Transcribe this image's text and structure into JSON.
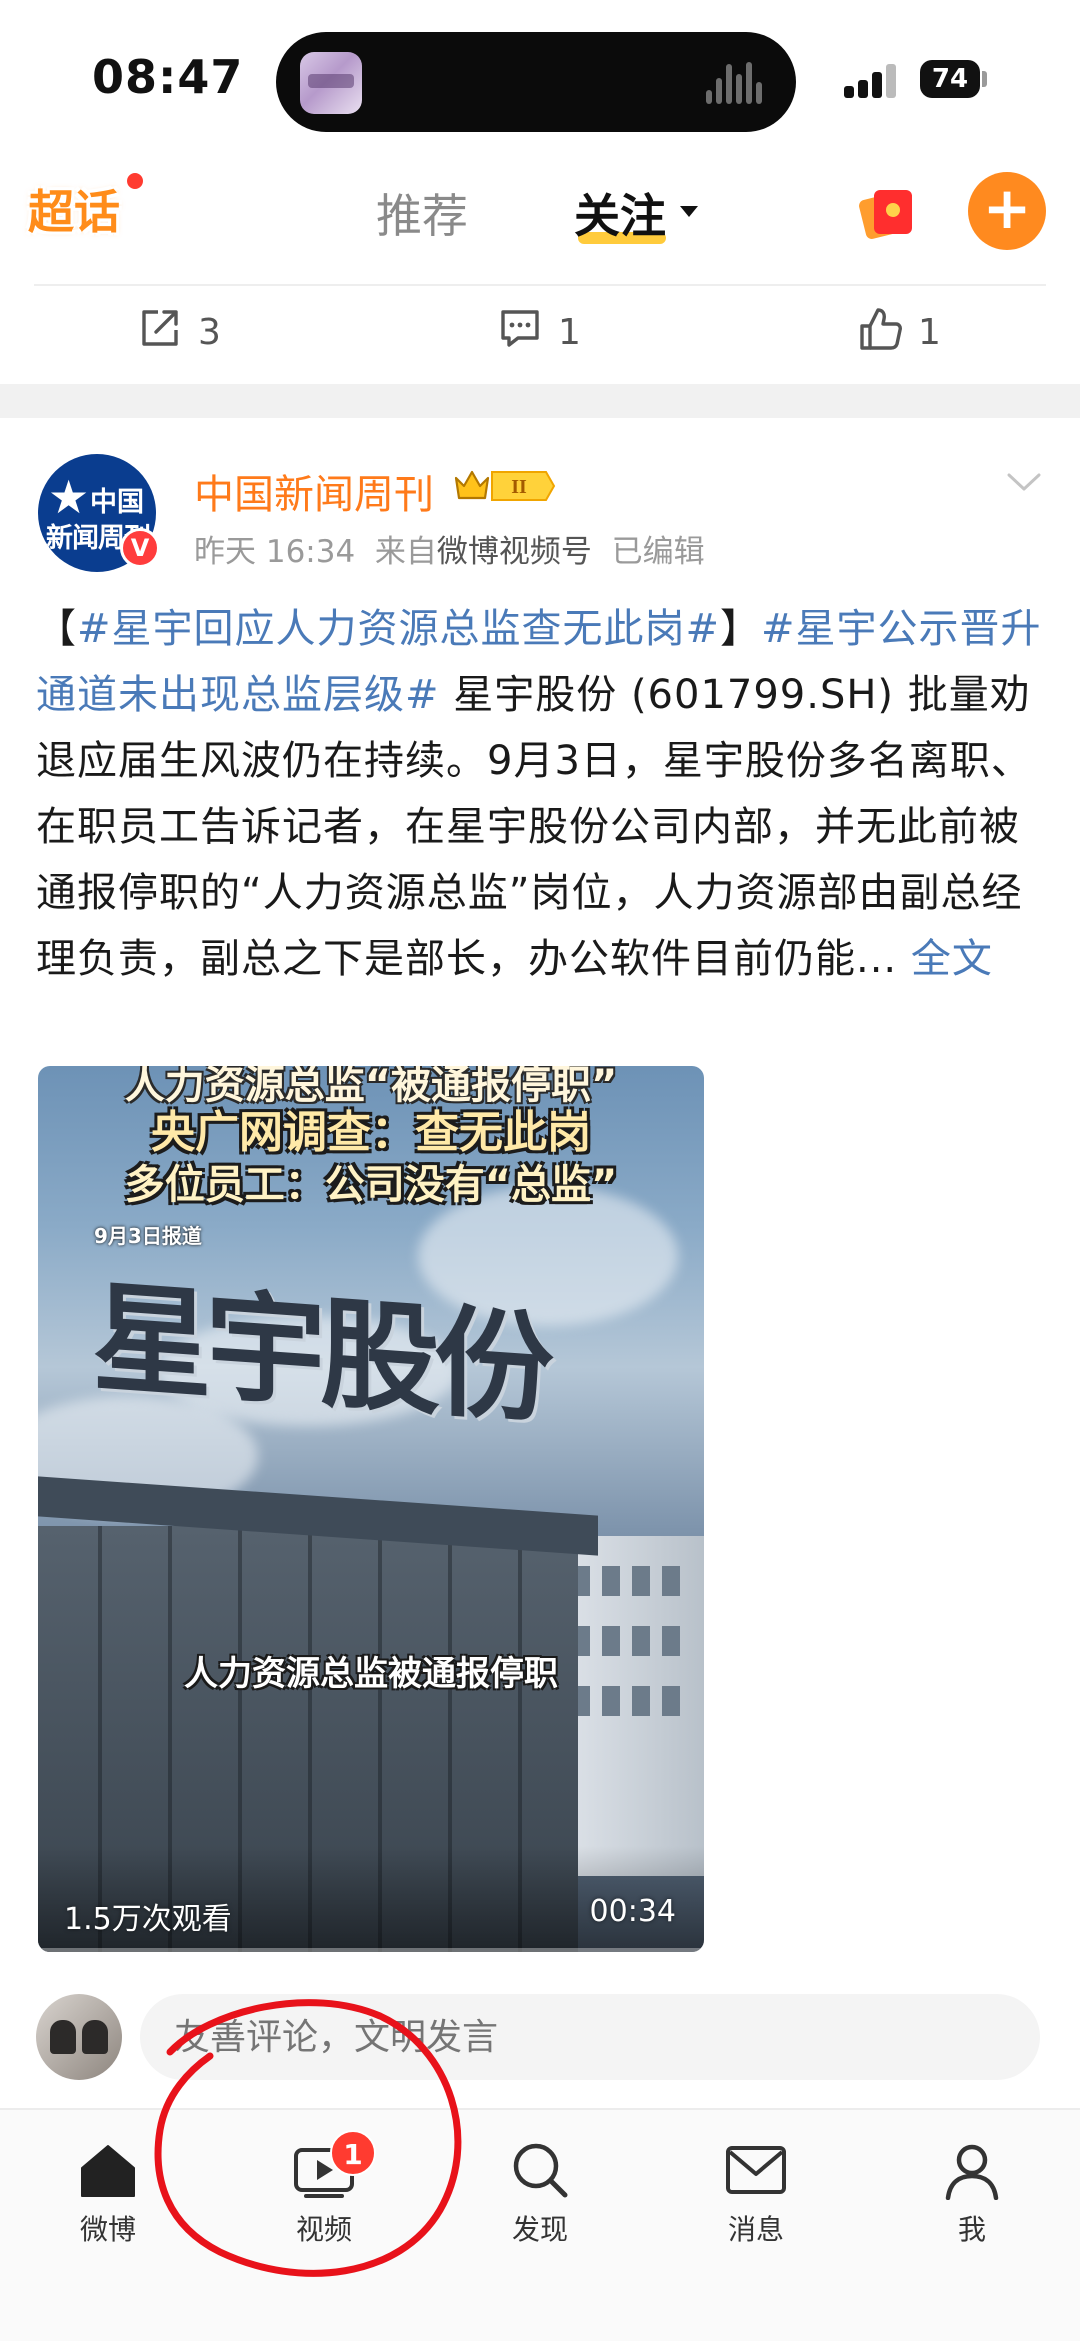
{
  "status_bar": {
    "time": "08:47",
    "battery": "74"
  },
  "top_nav": {
    "logo": "超话",
    "tabs": [
      {
        "label": "推荐"
      },
      {
        "label": "关注"
      }
    ]
  },
  "prev_post_actions": {
    "repost_count": "3",
    "comment_count": "1",
    "like_count": "1"
  },
  "post": {
    "author": "中国新闻周刊",
    "avatar_text_1": "中国",
    "avatar_text_2": "新闻周刊",
    "verified": "V",
    "vip_level": "II",
    "time": "昨天 16:34",
    "from_prefix": "来自",
    "source": "微博视频号",
    "edited": "已编辑",
    "body": {
      "bracket_open": "【",
      "tag1": "#星宇回应人力资源总监查无此岗#",
      "bracket_close": "】",
      "tag2": "#星宇公示晋升通道未出现总监层级#",
      "text": " 星宇股份 (601799.SH) 批量劝退应届生风波仍在持续。9月3日，星宇股份多名离职、在职员工告诉记者，在星宇股份公司内部，并无此前被通报停职的“人力资源总监”岗位，人力资源部由副总经理负责，副总之下是部长，办公软件目前仍能...",
      "full_text_link": "全文"
    },
    "video": {
      "caption_1": "人力资源总监“被通报停职”",
      "caption_2": "央广网调查：查无此岗",
      "caption_3": "多位员工：公司没有“总监”",
      "date_label": "9月3日报道",
      "sign_text": "星宇股份",
      "subtitle": "人力资源总监被通报停职",
      "views": "1.5万次观看",
      "duration": "00:34"
    }
  },
  "comment_box": {
    "placeholder": "友善评论，文明发言"
  },
  "bottom_nav": {
    "items": [
      {
        "label": "微博"
      },
      {
        "label": "视频",
        "badge": "1"
      },
      {
        "label": "发现"
      },
      {
        "label": "消息"
      },
      {
        "label": "我"
      }
    ]
  },
  "colors": {
    "accent": "#ff8a1f",
    "link": "#4a7ab8",
    "author": "#ff7a1a",
    "badge": "#ff3b30"
  }
}
